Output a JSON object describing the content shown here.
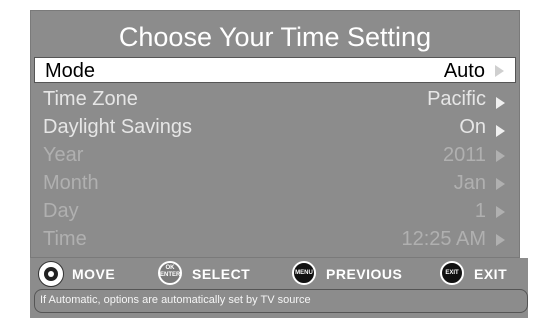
{
  "menu": {
    "title": "Choose Your Time Setting",
    "rows": [
      {
        "label": "Mode",
        "value": "Auto"
      },
      {
        "label": "Time Zone",
        "value": "Pacific"
      },
      {
        "label": "Daylight Savings",
        "value": "On"
      },
      {
        "label": "Year",
        "value": "2011"
      },
      {
        "label": "Month",
        "value": "Jan"
      },
      {
        "label": "Day",
        "value": "1"
      },
      {
        "label": "Time",
        "value": "12:25 AM"
      }
    ]
  },
  "controls": {
    "move_label": "MOVE",
    "select_label": "SELECT",
    "ok_icon_text": "OK ENTER",
    "previous_label": "PREVIOUS",
    "menu_icon_text": "MENU",
    "exit_label": "EXIT",
    "exit_icon_text": "EXIT"
  },
  "info": {
    "text": "If Automatic, options are automatically set by TV source"
  },
  "icons": {
    "move": "dpad-icon",
    "select": "ok-enter-icon",
    "previous": "menu-button-icon",
    "exit": "exit-button-icon",
    "row_arrow": "arrow-right-icon"
  },
  "colors": {
    "panel": "#8c8c8c",
    "selected_row": "#ffffff",
    "disabled_text": "#b0b0b0"
  }
}
